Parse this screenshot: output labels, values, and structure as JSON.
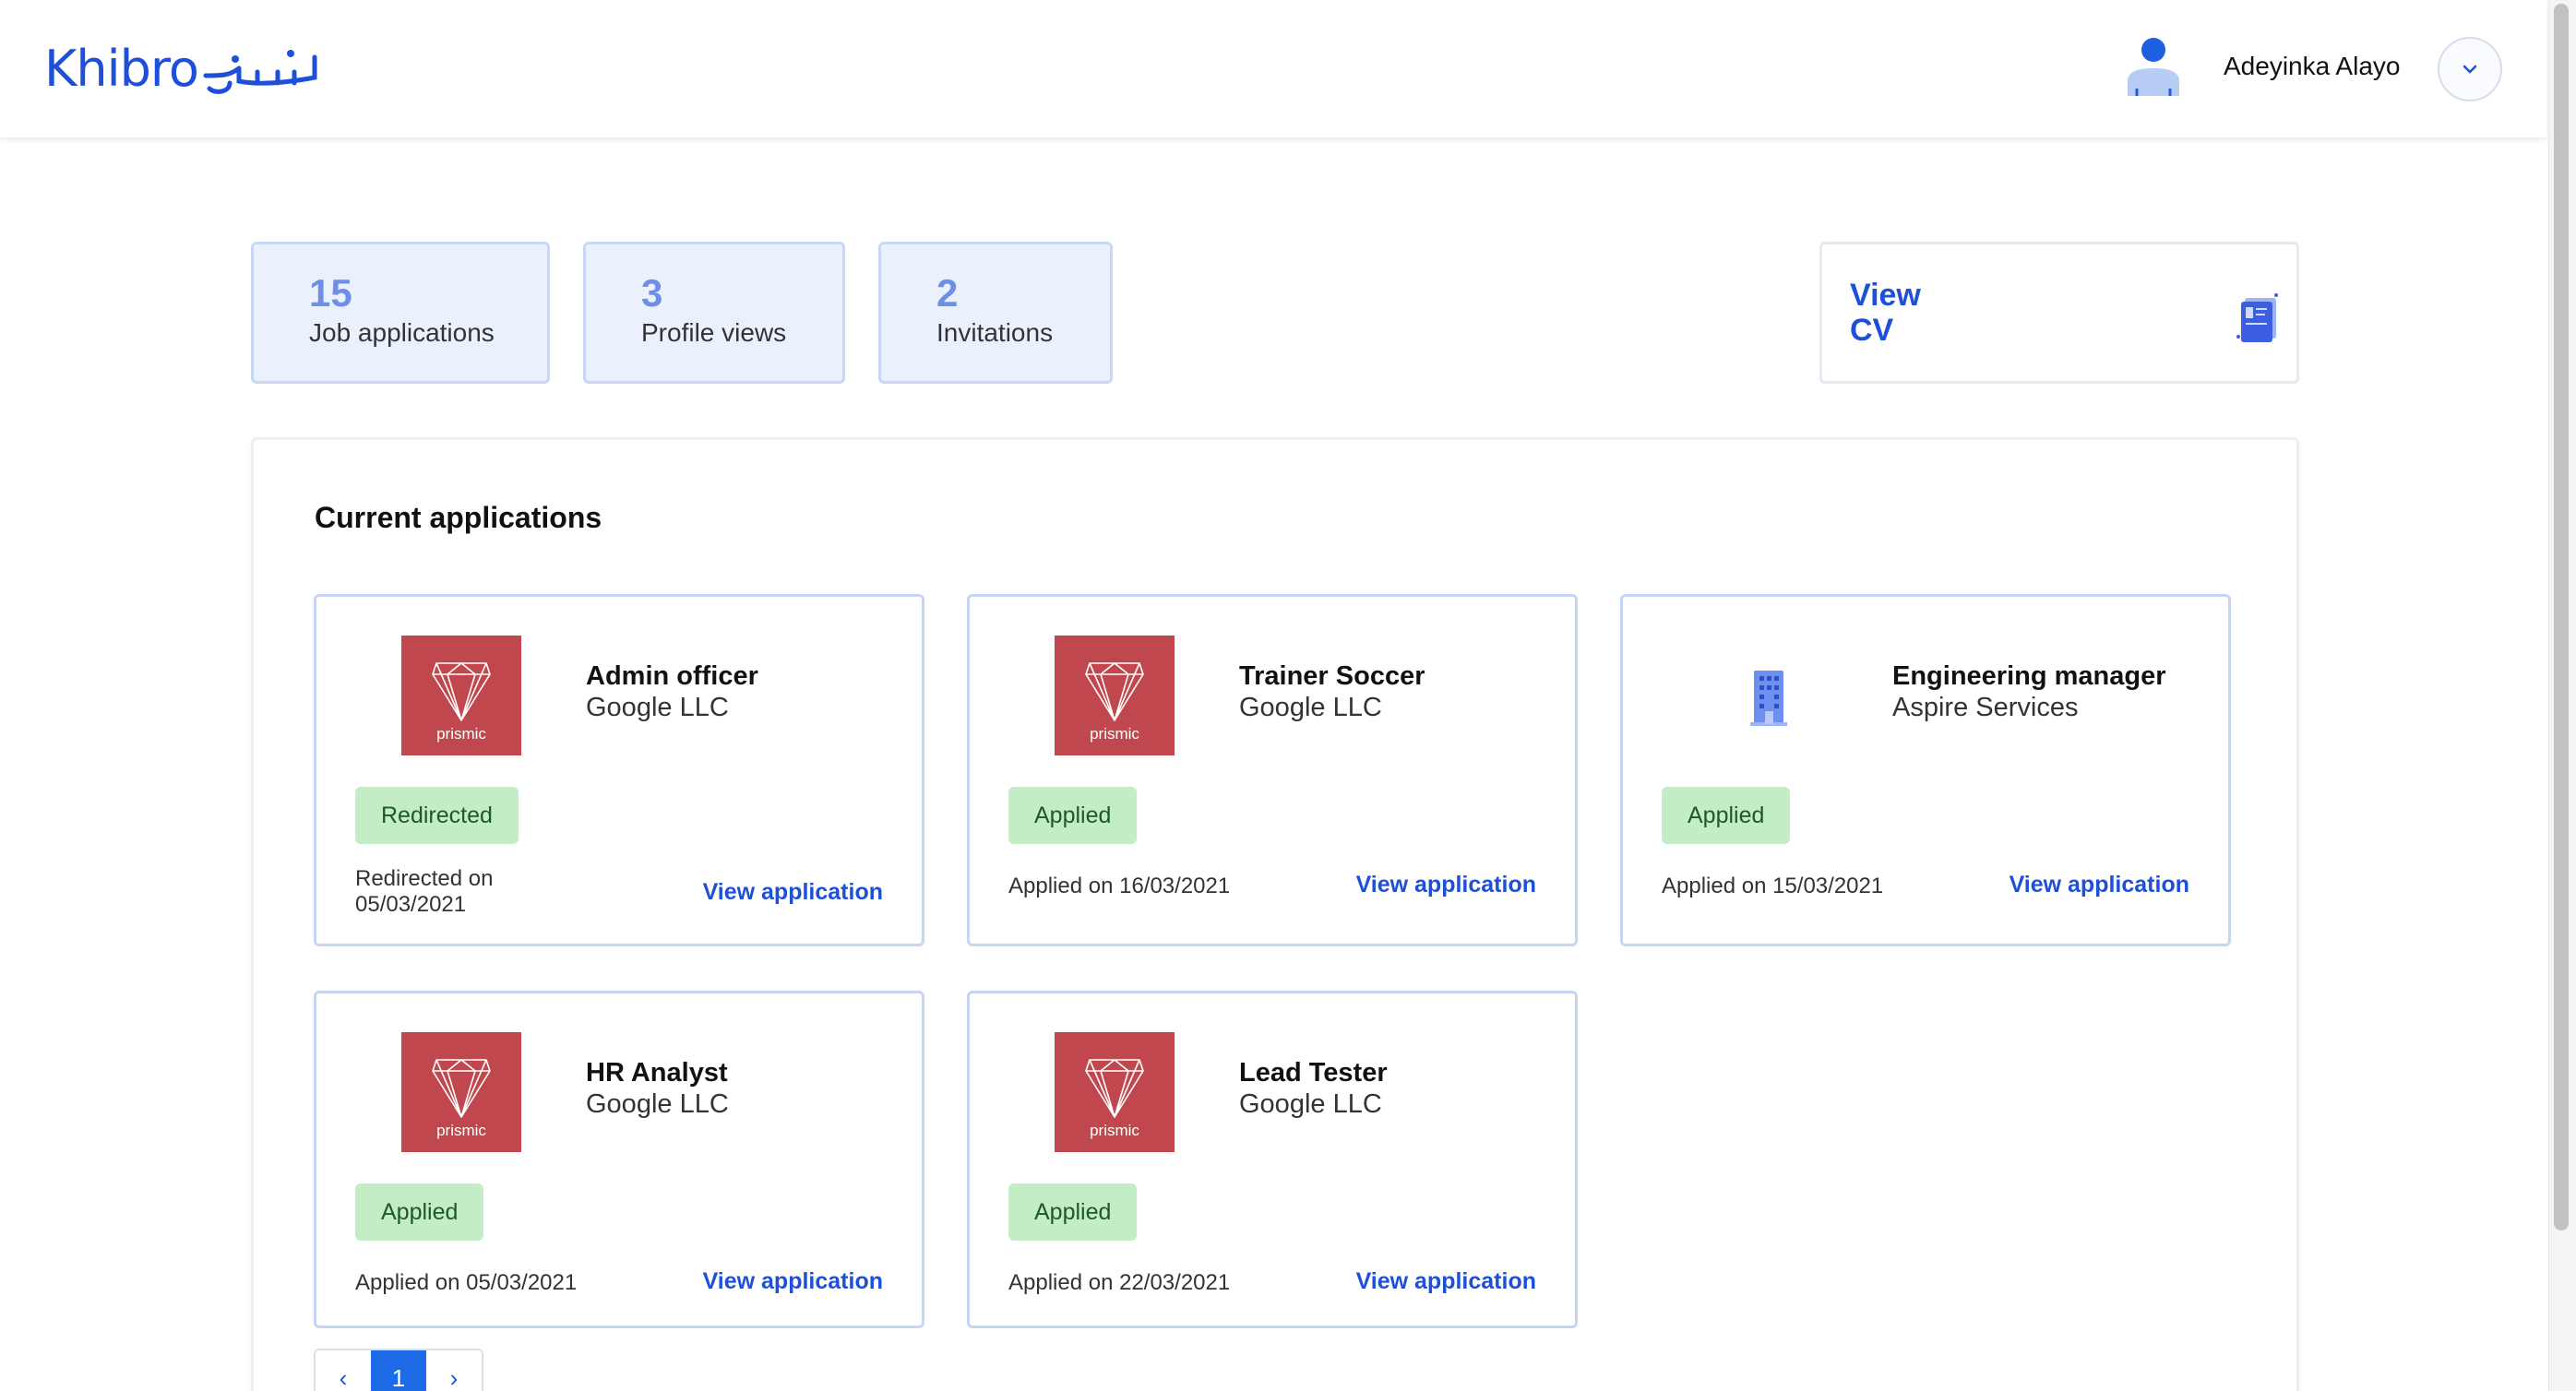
{
  "header": {
    "logo_text": "Khibro",
    "user_name": "Adeyinka Alayo"
  },
  "stats": [
    {
      "value": "15",
      "label": "Job applications"
    },
    {
      "value": "3",
      "label": "Profile views"
    },
    {
      "value": "2",
      "label": "Invitations"
    }
  ],
  "view_cv": {
    "line1": "View",
    "line2": "CV"
  },
  "applications": {
    "title": "Current applications",
    "link_label": "View application",
    "items": [
      {
        "job_title": "Admin officer",
        "company": "Google LLC",
        "status": "Redirected",
        "date_line1": "Redirected on",
        "date_line2": "05/03/2021",
        "logo": "prismic-logo",
        "logo_text": "prismic"
      },
      {
        "job_title": "Trainer Soccer",
        "company": "Google LLC",
        "status": "Applied",
        "date_line1": "Applied on 16/03/2021",
        "logo": "prismic-logo",
        "logo_text": "prismic"
      },
      {
        "job_title": "Engineering manager",
        "company": "Aspire Services",
        "status": "Applied",
        "date_line1": "Applied on 15/03/2021",
        "logo": "building-icon"
      },
      {
        "job_title": "HR Analyst",
        "company": "Google LLC",
        "status": "Applied",
        "date_line1": "Applied on 05/03/2021",
        "logo": "prismic-logo",
        "logo_text": "prismic"
      },
      {
        "job_title": "Lead Tester",
        "company": "Google LLC",
        "status": "Applied",
        "date_line1": "Applied on 22/03/2021",
        "logo": "prismic-logo",
        "logo_text": "prismic"
      }
    ]
  },
  "pagination": {
    "prev": "‹",
    "current": "1",
    "next": "›"
  },
  "colors": {
    "brand": "#1e4fd8",
    "stat_bg": "#eaf1fd",
    "badge_bg": "#c3edc5",
    "prismic_red": "#c0474d"
  }
}
